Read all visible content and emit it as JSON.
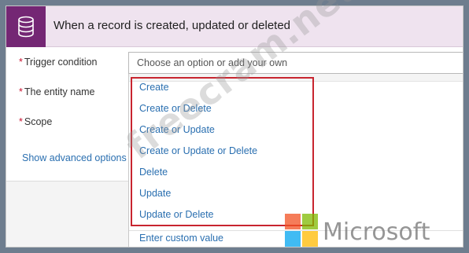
{
  "header": {
    "title": "When a record is created, updated or deleted",
    "icon": "database-icon",
    "icon_bg": "#742774"
  },
  "fields": {
    "required_marker": "*",
    "trigger_condition_label": "Trigger condition",
    "entity_name_label": "The entity name",
    "scope_label": "Scope"
  },
  "trigger_input": {
    "placeholder": "Choose an option or add your own"
  },
  "advanced_link": "Show advanced options",
  "dropdown": {
    "options": [
      "Create",
      "Create or Delete",
      "Create or Update",
      "Create or Update or Delete",
      "Delete",
      "Update",
      "Update or Delete"
    ],
    "custom_value": "Enter custom value",
    "highlight_color": "#c8252f",
    "link_color": "#2a6fb0"
  },
  "watermark": "freecram.net",
  "brand": {
    "name": "Microsoft",
    "colors": [
      "#f25022",
      "#7fba00",
      "#00a4ef",
      "#ffb900"
    ]
  }
}
